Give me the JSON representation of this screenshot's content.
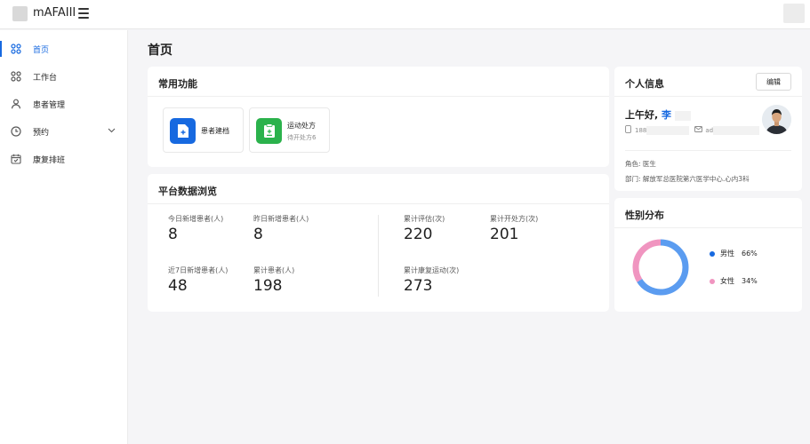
{
  "header": {
    "app_title": "mAFAIII",
    "menu_icon": "hamburger-icon"
  },
  "sidebar": {
    "items": [
      {
        "label": "首页",
        "icon": "dashboard-icon",
        "active": true
      },
      {
        "label": "工作台",
        "icon": "workbench-icon"
      },
      {
        "label": "患者管理",
        "icon": "user-icon"
      },
      {
        "label": "预约",
        "icon": "clock-icon",
        "has_submenu": true
      },
      {
        "label": "康复排班",
        "icon": "calendar-icon"
      }
    ]
  },
  "page": {
    "title": "首页"
  },
  "common_functions": {
    "title": "常用功能",
    "items": [
      {
        "label": "患者建档",
        "icon": "add-file-icon",
        "color": "#1769e0"
      },
      {
        "label": "运动处方",
        "sub": "待开处方6",
        "icon": "clipboard-icon",
        "color": "#2bb24c"
      }
    ]
  },
  "platform_stats": {
    "title": "平台数据浏览",
    "items": [
      {
        "label": "今日新增患者(人)",
        "value": "8"
      },
      {
        "label": "昨日新增患者(人)",
        "value": "8"
      },
      {
        "label": "近7日新增患者(人)",
        "value": "48"
      },
      {
        "label": "累计患者(人)",
        "value": "198"
      },
      {
        "label": "累计评估(次)",
        "value": "220"
      },
      {
        "label": "累计开处方(次)",
        "value": "201"
      },
      {
        "label": "累计康复运动(次)",
        "value": "273"
      }
    ]
  },
  "profile": {
    "title": "个人信息",
    "edit_label": "编辑",
    "greeting": "上午好,",
    "name": "李",
    "phone_prefix": "188",
    "email_prefix": "ad",
    "role": "角色:  医生",
    "department": "部门:  解放军总医院第六医学中心.心内3科"
  },
  "gender": {
    "title": "性别分布",
    "chart_data": {
      "type": "pie",
      "series": [
        {
          "name": "男性",
          "value": 66,
          "color": "#5b9cf0"
        },
        {
          "name": "女性",
          "value": 34,
          "color": "#f095c0"
        }
      ],
      "legend": [
        {
          "name": "男性",
          "pct": "66%",
          "dot_color": "#1769e0"
        },
        {
          "name": "女性",
          "pct": "34%",
          "dot_color": "#f095c0"
        }
      ]
    }
  }
}
